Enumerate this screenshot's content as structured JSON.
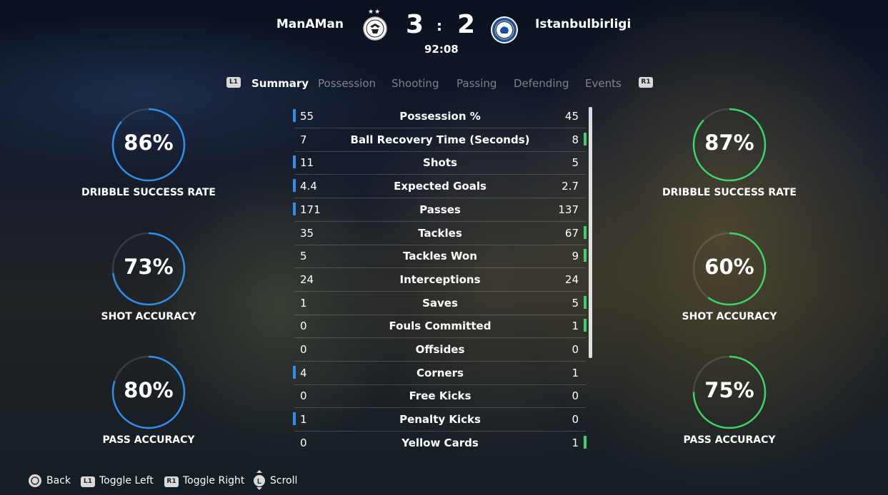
{
  "header": {
    "home_team": "ManAMan",
    "away_team": "Istanbulbirligi",
    "home_score": "3",
    "away_score": "2",
    "separator": ":",
    "match_clock": "92:08",
    "home_stars": "★★"
  },
  "tabs": {
    "left_button": "L1",
    "right_button": "R1",
    "items": [
      "Summary",
      "Possession",
      "Shooting",
      "Passing",
      "Defending",
      "Events"
    ],
    "active": "Summary"
  },
  "stats": [
    {
      "label": "Possession %",
      "home": "55",
      "away": "45",
      "lead": "home"
    },
    {
      "label": "Ball Recovery Time (Seconds)",
      "home": "7",
      "away": "8",
      "lead": "away"
    },
    {
      "label": "Shots",
      "home": "11",
      "away": "5",
      "lead": "home"
    },
    {
      "label": "Expected Goals",
      "home": "4.4",
      "away": "2.7",
      "lead": "home"
    },
    {
      "label": "Passes",
      "home": "171",
      "away": "137",
      "lead": "home"
    },
    {
      "label": "Tackles",
      "home": "35",
      "away": "67",
      "lead": "away"
    },
    {
      "label": "Tackles Won",
      "home": "5",
      "away": "9",
      "lead": "away"
    },
    {
      "label": "Interceptions",
      "home": "24",
      "away": "24",
      "lead": "none"
    },
    {
      "label": "Saves",
      "home": "1",
      "away": "5",
      "lead": "away"
    },
    {
      "label": "Fouls Committed",
      "home": "0",
      "away": "1",
      "lead": "away"
    },
    {
      "label": "Offsides",
      "home": "0",
      "away": "0",
      "lead": "none"
    },
    {
      "label": "Corners",
      "home": "4",
      "away": "1",
      "lead": "home"
    },
    {
      "label": "Free Kicks",
      "home": "0",
      "away": "0",
      "lead": "none"
    },
    {
      "label": "Penalty Kicks",
      "home": "1",
      "away": "0",
      "lead": "home"
    },
    {
      "label": "Yellow Cards",
      "home": "0",
      "away": "1",
      "lead": "away"
    }
  ],
  "home_rings": [
    {
      "value": "86%",
      "fraction": 0.86,
      "label": "DRIBBLE SUCCESS RATE"
    },
    {
      "value": "73%",
      "fraction": 0.73,
      "label": "SHOT ACCURACY"
    },
    {
      "value": "80%",
      "fraction": 0.8,
      "label": "PASS ACCURACY"
    }
  ],
  "away_rings": [
    {
      "value": "87%",
      "fraction": 0.87,
      "label": "DRIBBLE SUCCESS RATE"
    },
    {
      "value": "60%",
      "fraction": 0.6,
      "label": "SHOT ACCURACY"
    },
    {
      "value": "75%",
      "fraction": 0.75,
      "label": "PASS ACCURACY"
    }
  ],
  "footer": {
    "back": "Back",
    "toggle_left": "Toggle Left",
    "toggle_right": "Toggle Right",
    "scroll": "Scroll",
    "l1": "L1",
    "r1": "R1",
    "l_stick": "L"
  },
  "colors": {
    "home_accent": "#2f8ee8",
    "away_accent": "#3ad46a"
  }
}
